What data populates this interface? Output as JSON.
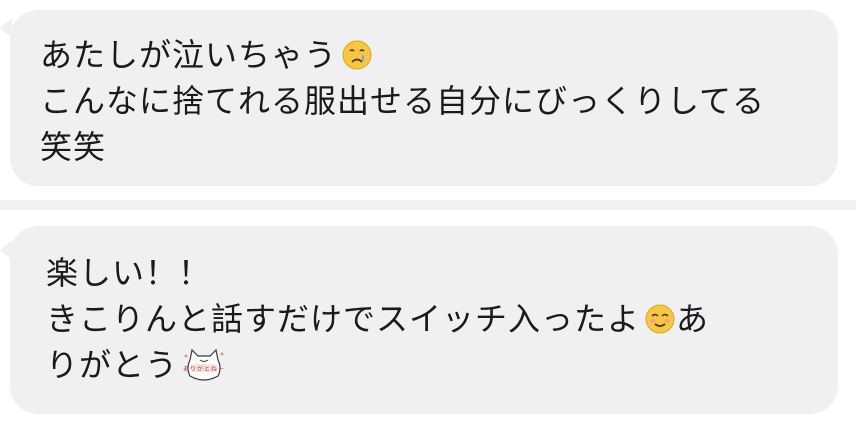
{
  "messages": [
    {
      "lines": [
        "あたしが泣いちゃう",
        "こんなに捨てれる服出せる自分にびっくりしてる",
        "笑笑"
      ],
      "emoji": "crying-face-icon"
    },
    {
      "lines": [
        "楽しい！！",
        "きこりんと話すだけでスイッチ入ったよ",
        "あ",
        "りがとう"
      ],
      "emoji": "smiling-face-icon",
      "sticker": "thank-you-cat-sticker",
      "sticker_text": "ありがとねー"
    }
  ],
  "colors": {
    "bubble": "#f0f0f3",
    "text": "#1a1a1a",
    "divider": "#f2f2f5"
  }
}
